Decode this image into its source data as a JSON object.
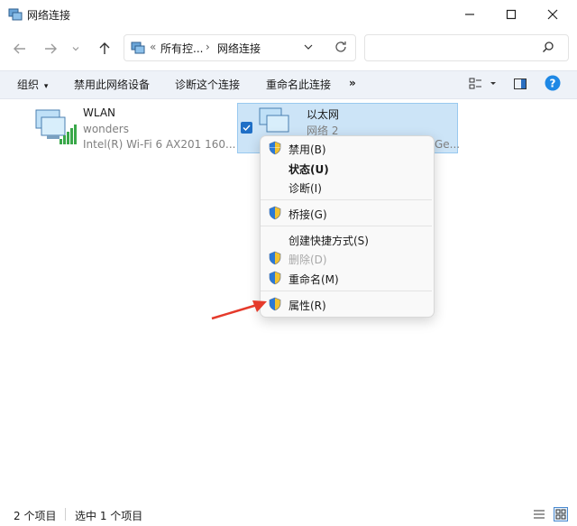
{
  "window": {
    "title": "网络连接"
  },
  "addressbar": {
    "crumb_prefix": "«",
    "crumb1": "所有控...",
    "separator": "›",
    "crumb2": "网络连接"
  },
  "toolbar": {
    "organize": "组织",
    "organize_arrow": "▾",
    "disable": "禁用此网络设备",
    "diagnose": "诊断这个连接",
    "rename": "重命名此连接",
    "more": "»"
  },
  "items": [
    {
      "name": "WLAN",
      "line2": "wonders",
      "line3": "Intel(R) Wi-Fi 6 AX201 160..."
    },
    {
      "name": "以太网",
      "line2": "网络 2",
      "line3": "Ge..."
    }
  ],
  "context_menu": {
    "disable": "禁用(B)",
    "status": "状态(U)",
    "diagnose": "诊断(I)",
    "bridge": "桥接(G)",
    "shortcut": "创建快捷方式(S)",
    "delete": "删除(D)",
    "rename": "重命名(M)",
    "properties": "属性(R)"
  },
  "statusbar": {
    "count": "2 个项目",
    "selected": "选中 1 个项目"
  },
  "colors": {
    "accent": "#1f6fc6",
    "selection": "#cce4f7",
    "arrow": "#e53a2b",
    "help": "#1e88e5"
  }
}
